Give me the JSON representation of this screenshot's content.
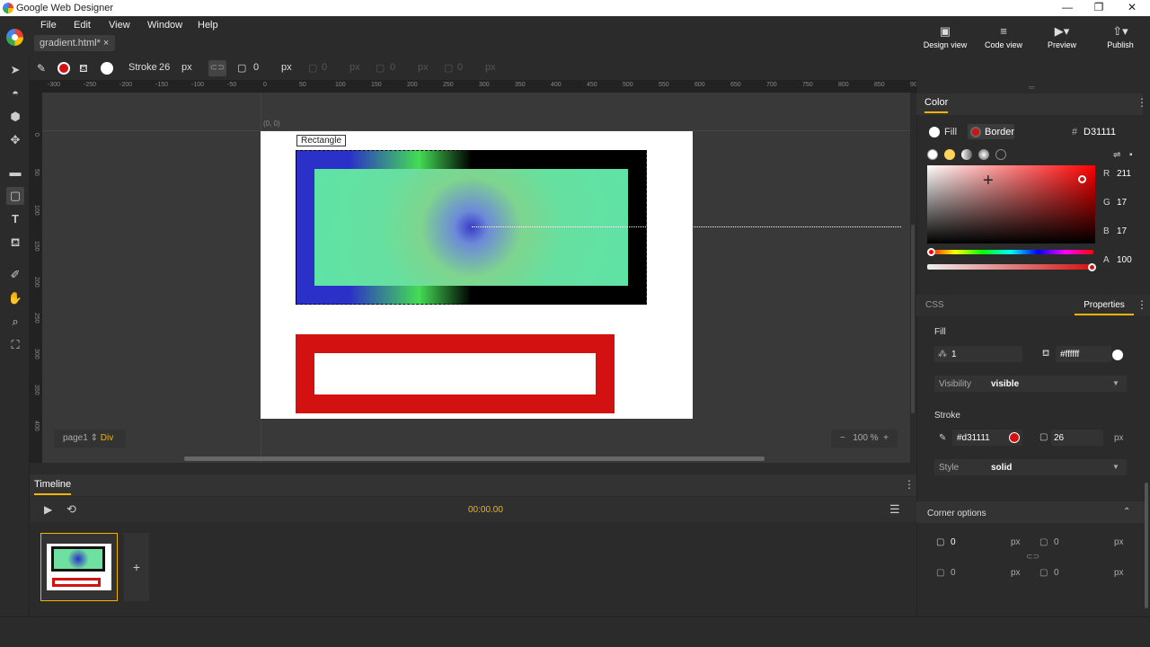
{
  "window": {
    "title": "Google Web Designer",
    "minimize": "—",
    "maximize": "❐",
    "close": "✕"
  },
  "menu": [
    "File",
    "Edit",
    "View",
    "Window",
    "Help"
  ],
  "document_tab": "gradient.html* ×",
  "views": [
    {
      "label": "Design view",
      "icon": "▣"
    },
    {
      "label": "Code view",
      "icon": "≡"
    },
    {
      "label": "Preview",
      "icon": "▶▾"
    },
    {
      "label": "Publish",
      "icon": "⇧▾"
    }
  ],
  "tool_options": {
    "stroke_label": "Stroke",
    "stroke_value": "26",
    "stroke_unit": "px",
    "corner_value": "0",
    "corner_unit": "px",
    "corner2_value": "0",
    "corner2_unit": "px",
    "corner3_value": "0",
    "corner3_unit": "px",
    "corner4_value": "0",
    "corner4_unit": "px"
  },
  "ruler_h": [
    "-300",
    "-250",
    "-200",
    "-150",
    "-100",
    "-50",
    "0",
    "50",
    "100",
    "150",
    "200",
    "250",
    "300",
    "350",
    "400",
    "450",
    "500",
    "550",
    "600",
    "650",
    "700",
    "750",
    "800",
    "850",
    "900"
  ],
  "ruler_v": [
    "0",
    "50",
    "100",
    "150",
    "200",
    "250",
    "300",
    "350",
    "400"
  ],
  "stage": {
    "origin": "(0, 0)",
    "selected_label": "Rectangle",
    "page_name": "page1 ⇕",
    "element_type": "Div",
    "zoom": "100 %",
    "zoom_minus": "−",
    "zoom_plus": "+"
  },
  "timeline": {
    "title": "Timeline",
    "time": "00:00.00",
    "add": "+"
  },
  "color_panel": {
    "title": "Color",
    "fill_label": "Fill",
    "border_label": "Border",
    "hex_prefix": "#",
    "hex": "D31111",
    "r_label": "R",
    "r": "211",
    "g_label": "G",
    "g": "17",
    "b_label": "B",
    "b": "17",
    "a_label": "A",
    "a": "100"
  },
  "properties": {
    "css_tab": "CSS",
    "properties_tab": "Properties",
    "fill_section": "Fill",
    "fill_opacity": "1",
    "fill_color": "#ffffff",
    "visibility_label": "Visibility",
    "visibility_value": "visible",
    "stroke_section": "Stroke",
    "stroke_color": "#d31111",
    "stroke_width": "26",
    "stroke_unit": "px",
    "style_label": "Style",
    "style_value": "solid",
    "corner_section": "Corner options",
    "corner_tl": "0",
    "corner_tr": "0",
    "corner_bl": "0",
    "corner_br": "0",
    "corner_unit": "px"
  },
  "colors": {
    "accent": "#f4b400",
    "border": "#d31111",
    "dark_bg": "#2b2b2b",
    "stage_bg": "#393939"
  }
}
